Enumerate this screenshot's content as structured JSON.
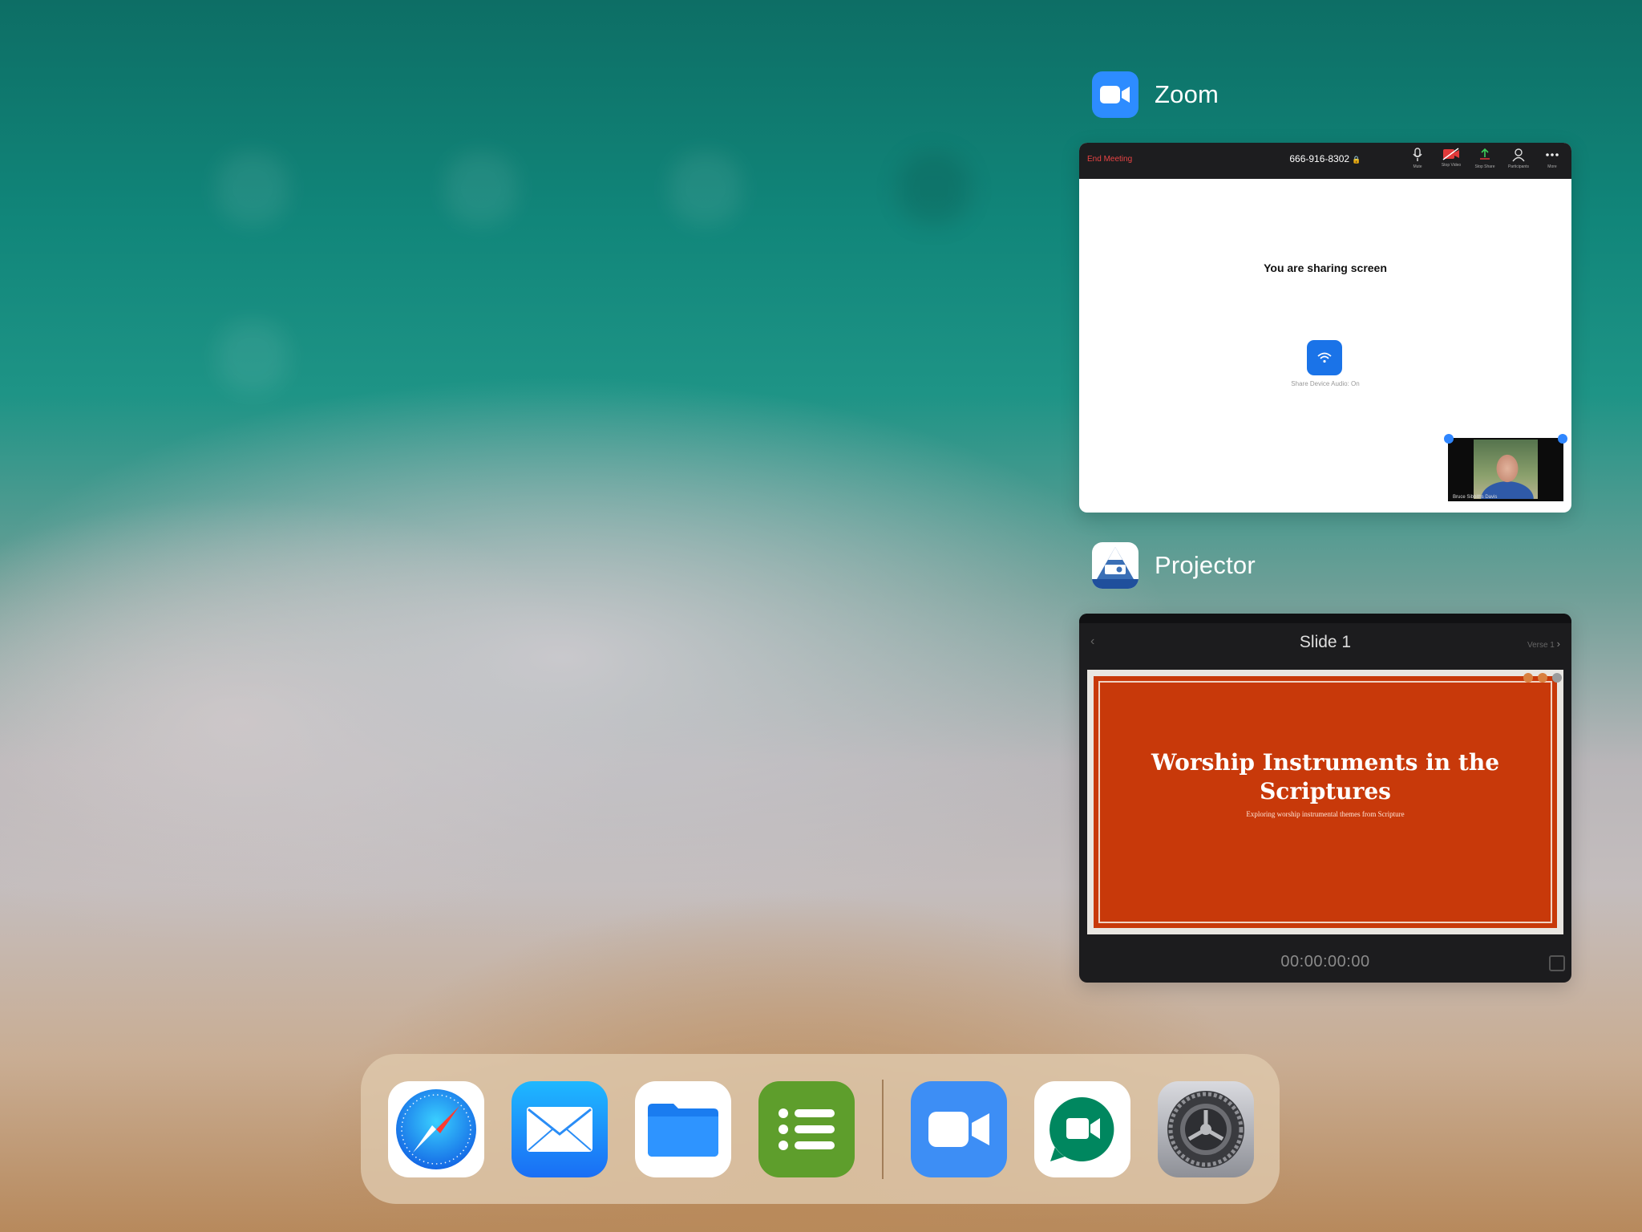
{
  "switcher": {
    "zoom": {
      "app_name": "Zoom",
      "end_meeting": "End Meeting",
      "meeting_id": "666-916-8302",
      "lock_glyph": "🔒",
      "tools": [
        {
          "label": "Mute",
          "icon": "microphone-icon"
        },
        {
          "label": "Stop Video",
          "icon": "video-off-icon"
        },
        {
          "label": "Stop Share",
          "icon": "share-screen-icon"
        },
        {
          "label": "Participants",
          "icon": "participants-icon"
        },
        {
          "label": "More",
          "icon": "more-icon"
        }
      ],
      "sharing_text": "You are sharing screen",
      "share_audio_caption": "Share Device Audio: On",
      "participant_name": "Bruce Sibbiths Davis"
    },
    "projector": {
      "app_name": "Projector",
      "slide_header": "Slide 1",
      "verse_label": "Verse 1",
      "slide_title": "Worship Instruments in the Scriptures",
      "slide_subtitle": "Exploring worship instrumental themes from Scripture",
      "timecode": "00:00:00:00"
    }
  },
  "dock": {
    "apps": [
      "Safari",
      "Mail",
      "Files",
      "Lists",
      "Zoom",
      "Google Meet",
      "Settings"
    ]
  },
  "colors": {
    "zoom_blue": "#2d8cff",
    "slide_orange": "#c8390a",
    "end_meeting_red": "#e94444"
  }
}
